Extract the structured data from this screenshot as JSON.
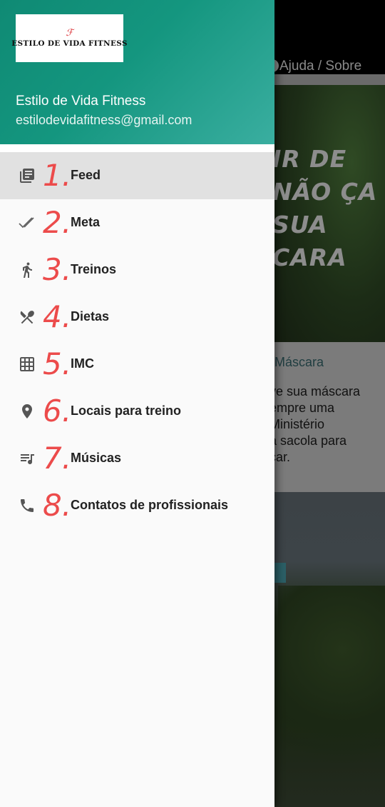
{
  "background": {
    "help_link": "Ajuda / Sobre",
    "hero_text": "IR DE NÃO ÇA SUA CARA",
    "card_title": "Máscara",
    "card_body": "ve sua máscara\nempre uma\n Ministério\na sacola para\ncar."
  },
  "drawer": {
    "logo_mark": "ℱ",
    "logo_text": "ESTILO DE VIDA FITNESS",
    "user_name": "Estilo de Vida Fitness",
    "user_email": "estilodevidafitness@gmail.com",
    "items": [
      {
        "number": "1.",
        "label": "Feed",
        "icon": "feed-icon",
        "active": true
      },
      {
        "number": "2.",
        "label": "Meta",
        "icon": "double-check-icon"
      },
      {
        "number": "3.",
        "label": "Treinos",
        "icon": "running-icon"
      },
      {
        "number": "4.",
        "label": "Dietas",
        "icon": "utensils-icon"
      },
      {
        "number": "5.",
        "label": "IMC",
        "icon": "grid-icon"
      },
      {
        "number": "6.",
        "label": "Locais para treino",
        "icon": "location-pin-icon"
      },
      {
        "number": "7.",
        "label": "Músicas",
        "icon": "music-list-icon"
      },
      {
        "number": "8.",
        "label": "Contatos de profissionais",
        "icon": "phone-icon"
      }
    ]
  },
  "colors": {
    "header_accent": "#14967f",
    "number_annotation": "#ec4b4b",
    "active_item_bg": "#e1e1e1"
  }
}
